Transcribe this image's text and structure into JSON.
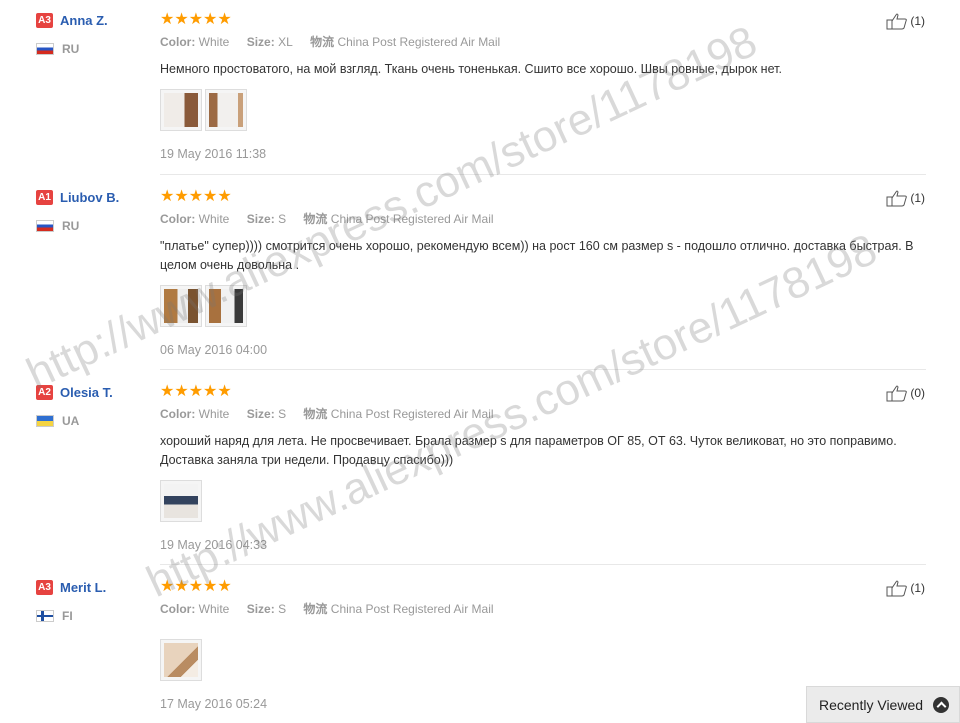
{
  "labels": {
    "color": "Color:",
    "size": "Size:",
    "shipping_prefix": "物流"
  },
  "reviews": [
    {
      "level": "A3",
      "name": "Anna Z.",
      "country": "RU",
      "color": "White",
      "size": "XL",
      "shipping": "China Post Registered Air Mail",
      "text": "Немного простоватого, на мой взгляд. Ткань очень тоненькая. Сшито все хорошо. Швы ровные, дырок нет.",
      "date": "19 May 2016 11:38",
      "helpful": "(1)"
    },
    {
      "level": "A1",
      "name": "Liubov B.",
      "country": "RU",
      "color": "White",
      "size": "S",
      "shipping": "China Post Registered Air Mail",
      "text": "\"платье\" супер)))) смотрится очень хорошо, рекомендую всем)) на рост 160 см размер s - подошло отлично. доставка быстрая. В целом очень довольна .",
      "date": "06 May 2016 04:00",
      "helpful": "(1)"
    },
    {
      "level": "A2",
      "name": "Olesia T.",
      "country": "UA",
      "color": "White",
      "size": "S",
      "shipping": "China Post Registered Air Mail",
      "text": "хороший наряд для лета. Не просвечивает. Брала размер s для параметров ОГ 85, ОТ 63. Чуток великоват, но это поправимо. Доставка заняла три недели. Продавцу спасибо)))",
      "date": "19 May 2016 04:33",
      "helpful": "(0)"
    },
    {
      "level": "A3",
      "name": "Merit L.",
      "country": "FI",
      "color": "White",
      "size": "S",
      "shipping": "China Post Registered Air Mail",
      "text": "",
      "date": "17 May 2016 05:24",
      "helpful": "(1)"
    }
  ],
  "watermark": {
    "line1": "http://www.aliexpress.com/store/1178198",
    "line2": "http://www.aliexpress.com/store/1178198"
  },
  "recently_viewed": "Recently Viewed",
  "colors": {
    "level_badge": "#e64340",
    "name_link": "#2a5db0",
    "stars": "#ff9c00"
  }
}
